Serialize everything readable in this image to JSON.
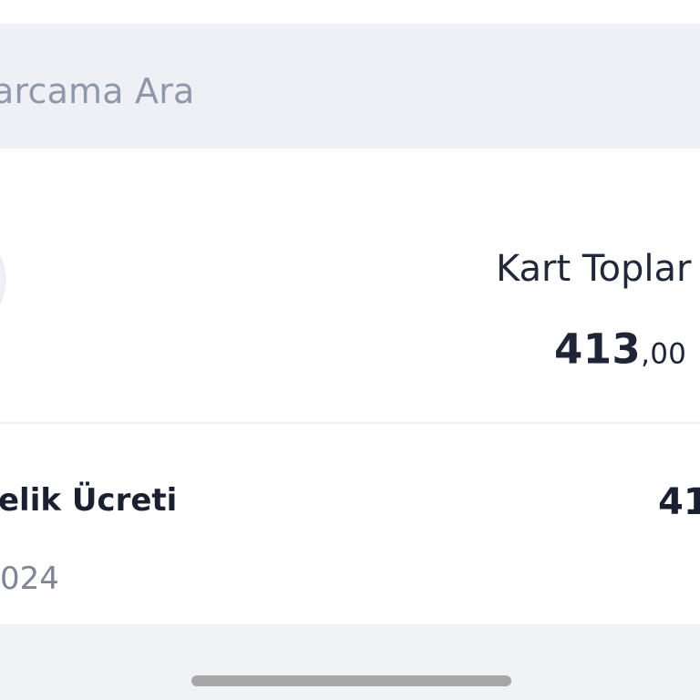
{
  "search": {
    "text": "arcama Ara"
  },
  "card_summary": {
    "total_label": "Kart Toplar",
    "total_amount_integer": "413",
    "total_amount_fraction": ",00 "
  },
  "transaction": {
    "title": "elik Ücreti",
    "amount": "41",
    "date": "024"
  },
  "colors": {
    "background": "#f0f2f6",
    "surface": "#ffffff",
    "search_background": "#eef0f5",
    "primary_text": "#1f2536",
    "secondary_text": "#7f8596",
    "placeholder_text": "#8f97aa",
    "home_indicator": "#a7a7a7"
  }
}
